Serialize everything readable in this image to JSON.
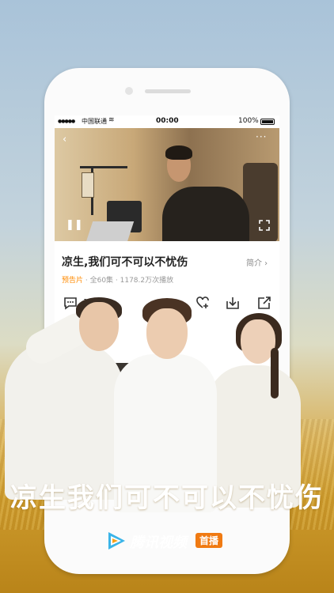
{
  "status_bar": {
    "carrier": "中国联通",
    "time": "00:00",
    "battery": "100%"
  },
  "video": {
    "back_icon": "back-arrow-icon",
    "more_icon": "more-dots-icon",
    "play_icon": "pause-icon",
    "fullscreen_icon": "fullscreen-icon"
  },
  "show": {
    "title": "凉生,我们可不可以不忧伤",
    "intro_link": "简介 ›",
    "tag": "预告片",
    "meta": " · 全60集 · 1178.2万次播放"
  },
  "actions": {
    "comment_count": "1",
    "icons": [
      "comment-icon",
      "follow-icon",
      "download-icon",
      "share-icon"
    ]
  },
  "promo": {
    "tagline": "凉生我们可不可以不忧伤",
    "app_name": "腾讯视频",
    "badge": "首播"
  },
  "colors": {
    "accent_orange": "#ff8a00",
    "badge_orange": "#f07a12"
  }
}
